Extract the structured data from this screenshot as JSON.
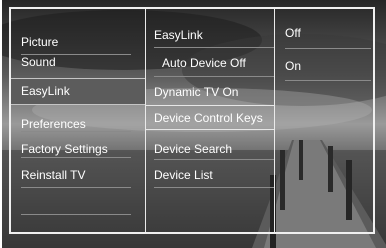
{
  "menu": {
    "level1": [
      {
        "label": "Picture",
        "selected": false
      },
      {
        "label": "Sound",
        "selected": false
      },
      {
        "label": "EasyLink",
        "selected": true
      },
      {
        "label": "Preferences",
        "selected": false
      },
      {
        "label": "Factory Settings",
        "selected": false
      },
      {
        "label": "Reinstall TV",
        "selected": false
      }
    ],
    "level2": [
      {
        "label": "EasyLink"
      },
      {
        "label": "Auto Device Off"
      },
      {
        "label": "Dynamic TV On"
      },
      {
        "label": "Device Control Keys",
        "selected": true
      },
      {
        "label": "Device Search"
      },
      {
        "label": "Device List"
      }
    ],
    "level3": [
      {
        "label": "Off"
      },
      {
        "label": "On"
      }
    ]
  },
  "colors": {
    "text": "#ffffff",
    "selected_bg": "#5c5c5c",
    "frame": "#f0f0f0"
  }
}
